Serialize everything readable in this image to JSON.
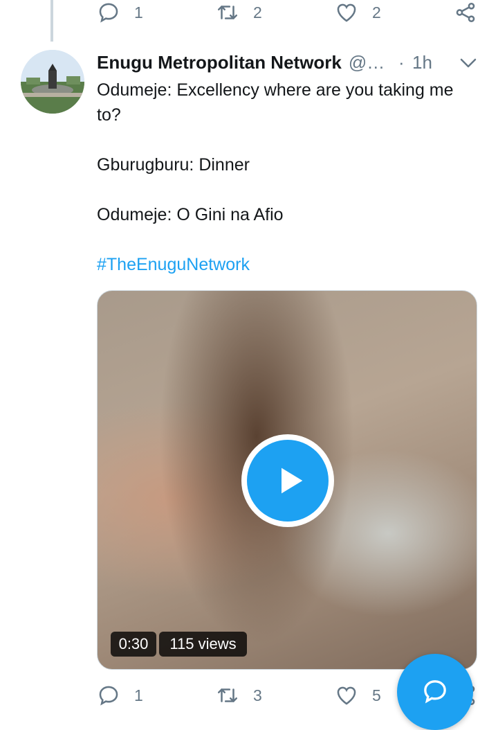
{
  "previous_tweet": {
    "actions": {
      "reply_count": "1",
      "retweet_count": "2",
      "like_count": "2",
      "icons": [
        "reply-icon",
        "retweet-icon",
        "like-icon",
        "share-icon"
      ]
    }
  },
  "tweet": {
    "author_name": "Enugu Metropolitan Network",
    "handle": "@…",
    "separator": "·",
    "time": "1h",
    "text_lines": [
      "Odumeje: Excellency where are you taking me to?",
      "Gburugburu: Dinner",
      "Odumeje: O Gini na Afio"
    ],
    "hashtag": "#TheEnuguNetwork",
    "video": {
      "duration": "0:30",
      "views": "115 views"
    },
    "actions": {
      "reply_count": "1",
      "retweet_count": "3",
      "like_count": "5"
    }
  },
  "colors": {
    "accent": "#1da1f2",
    "secondary_text": "#657786",
    "primary_text": "#14171a"
  },
  "fab": {
    "icon": "compose-reply-icon"
  }
}
